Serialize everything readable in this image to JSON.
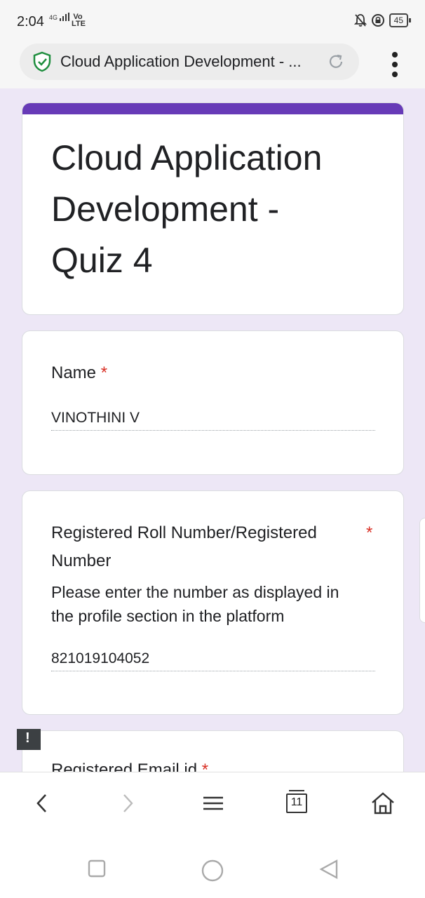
{
  "status_bar": {
    "time": "2:04",
    "network": "4G",
    "volte": "Vo LTE",
    "battery": "45"
  },
  "browser": {
    "url_title": "Cloud Application Development - ...",
    "tab_count": "11"
  },
  "form": {
    "title_lines": [
      "Cloud Application",
      "Development -",
      "Quiz 4"
    ],
    "questions": [
      {
        "label": "Name",
        "required_mark": "*",
        "answer": "VINOTHINI V"
      },
      {
        "label_lines": [
          "Registered Roll Number/Registered",
          "Number"
        ],
        "required_mark": "*",
        "description_lines": [
          "Please enter the number as displayed in",
          "the profile section in the platform"
        ],
        "answer": "821019104052"
      },
      {
        "label": "Registered Email id",
        "required_mark": "*"
      }
    ],
    "feedback_icon": "!"
  },
  "colors": {
    "accent": "#673ab7",
    "background": "#ede7f6",
    "required": "#d93025",
    "secure": "#1e8e3e"
  }
}
